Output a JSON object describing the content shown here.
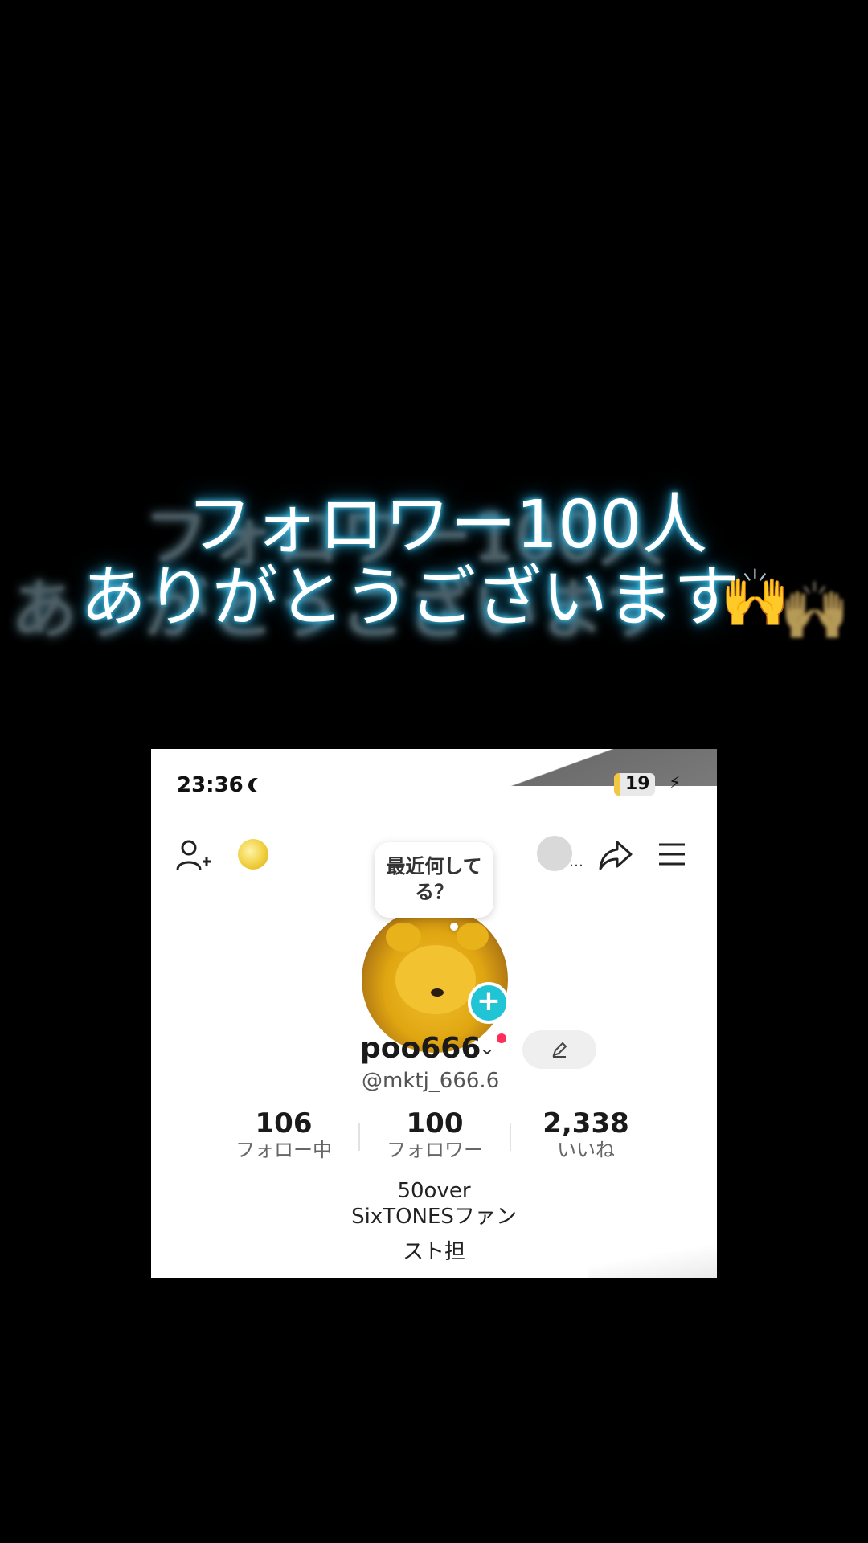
{
  "caption": {
    "line1": "フォロワー100人",
    "line2": "ありがとうございます",
    "emoji": "🙌"
  },
  "screenshot": {
    "status_bar": {
      "time": "23:36",
      "battery": "19"
    },
    "profile": {
      "thought_bubble": "最近何してる？",
      "username": "poo666",
      "handle": "@mktj_666.6",
      "stats": [
        {
          "value": "106",
          "label": "フォロー中"
        },
        {
          "value": "100",
          "label": "フォロワー"
        },
        {
          "value": "2,338",
          "label": "いいね"
        }
      ],
      "bio": [
        "50over",
        "SixTONESファン",
        "スト担"
      ]
    },
    "icons": [
      "add-user-icon",
      "coin-icon",
      "avatar-switcher-icon",
      "share-icon",
      "menu-icon",
      "edit-icon",
      "plus-icon",
      "moon-icon",
      "bolt-icon"
    ]
  }
}
